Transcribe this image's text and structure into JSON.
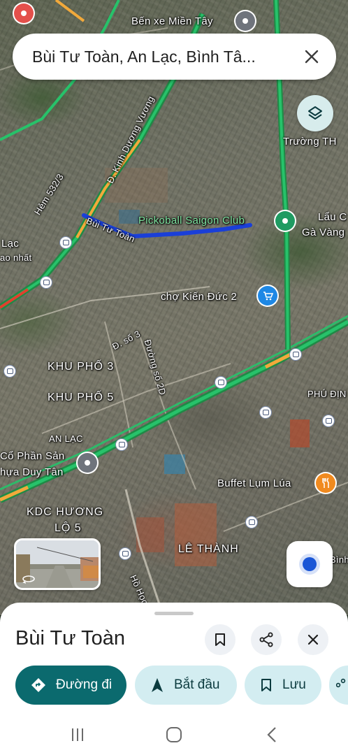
{
  "search": {
    "query": "Bùi Tư Toàn, An Lạc, Bình Tâ..."
  },
  "map": {
    "labels": {
      "ben_xe": "Bến xe Miền Tây",
      "truong": "Trường TH",
      "kinh_duong_vuong": "Đ. Kinh Dương Vương",
      "hem": "Hẻm 532/3",
      "bui_tu_toan": "Bùi Tư Toàn",
      "pickoball": "Pickoball Saigon Club",
      "lau": "Lẩu C",
      "ga_vang": "Gà Vàng",
      "lac": "Lạc",
      "ao_nhat": "ao nhất",
      "cho_kien_duc": "chợ Kiến Đức 2",
      "d_so_3": "Đ. số 3",
      "duong_so_2d": "Đường số 2D",
      "khu_pho_3": "KHU PHỐ 3",
      "khu_pho_5": "KHU PHỐ 5",
      "phu_dinh": "PHÚ ĐỊN",
      "an_lac": "AN LẠC",
      "co_phan_san": "Cổ Phần Sản",
      "nhua_duy_tan": "hựa Duy Tân",
      "buffet": "Buffet Lụm Lúa",
      "kdc_huong_lo": "KDC HƯƠNG",
      "lo_5": "LỘ 5",
      "le_thanh": "LÊ THÀNH",
      "ho_hoc": "Hồ Học",
      "binh": "Bình"
    },
    "icons": {
      "ben_xe_pin": "location-pin-icon",
      "pickoball_pin": "place-pin-icon",
      "cho_pin": "shopping-cart-icon",
      "buffet_pin": "restaurant-icon",
      "nhua_pin": "location-pin-icon"
    },
    "route_color": "#1a3fd8"
  },
  "sheet": {
    "title": "Bùi Tư Toàn",
    "buttons": {
      "directions": "Đường đi",
      "start": "Bắt đầu",
      "save": "Lưu"
    }
  },
  "colors": {
    "primary_chip": "#0b6a6e",
    "secondary_chip": "#d3edf1",
    "traffic_green": "#27c26a",
    "traffic_orange": "#f2a93b",
    "traffic_red": "#e0402e"
  }
}
